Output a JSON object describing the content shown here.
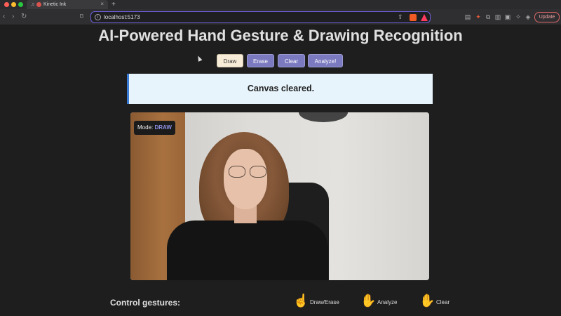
{
  "browser": {
    "tab_title": "Kinetic Ink",
    "url": "localhost:5173",
    "update_label": "Update",
    "icons": [
      "back-icon",
      "forward-icon",
      "reload-icon",
      "bookmark-icon",
      "share-icon",
      "brave-shield-icon",
      "rewards-icon",
      "extensions-icon",
      "sidebar-icon",
      "wallet-icon",
      "settings-icon",
      "vpn-icon"
    ]
  },
  "page": {
    "title": "AI-Powered Hand Gesture & Drawing Recognition",
    "buttons": {
      "draw": "Draw",
      "erase": "Erase",
      "clear": "Clear",
      "analyze": "Analyze!"
    },
    "active_button": "draw",
    "status_message": "Canvas cleared.",
    "mode": {
      "label": "Mode:",
      "value": "DRAW"
    },
    "gestures": {
      "heading": "Control gestures:",
      "items": [
        {
          "icon": "pointing-hand-icon",
          "glyph": "☝",
          "label": "Draw/Erase"
        },
        {
          "icon": "open-hand-icon",
          "glyph": "✋",
          "label": "Analyze"
        },
        {
          "icon": "raised-palm-icon",
          "glyph": "✋",
          "label": "Clear"
        }
      ]
    }
  },
  "colors": {
    "accent": "#7b7ac0",
    "active_button": "#f7ecd8",
    "status_bg": "#e8f4fc",
    "status_border": "#3a7bd5",
    "mode_value": "#8d8fe0"
  }
}
